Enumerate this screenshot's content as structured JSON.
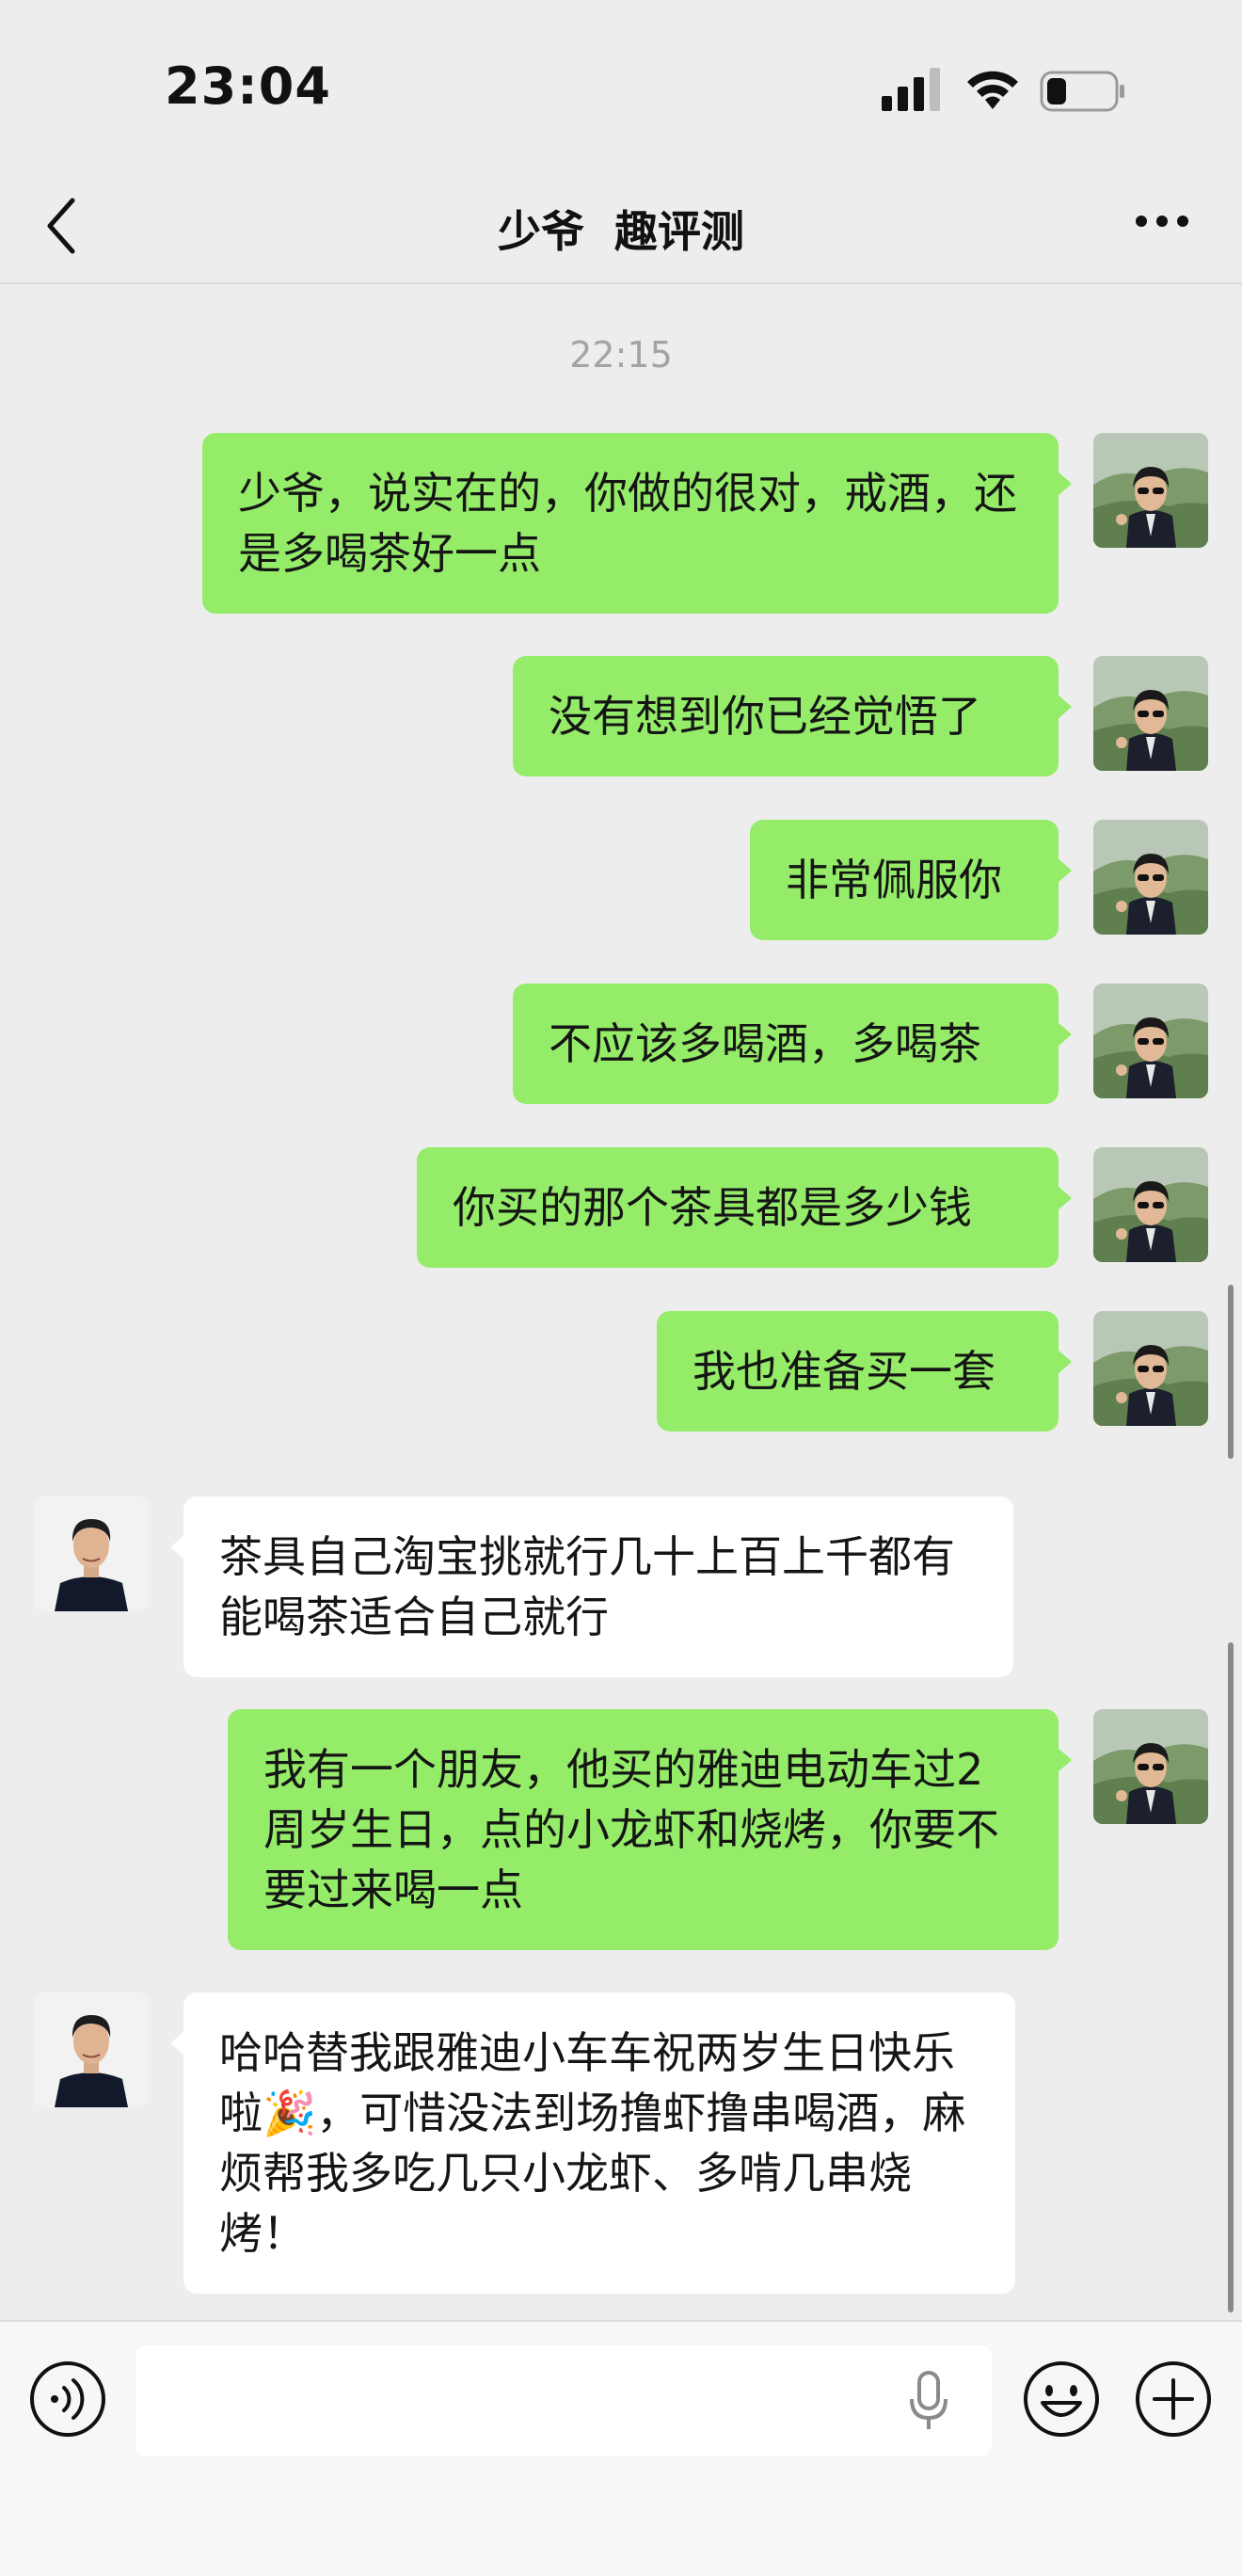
{
  "status_bar": {
    "time": "23:04",
    "icons": [
      "signal-icon",
      "wifi-icon",
      "battery-icon"
    ]
  },
  "nav": {
    "title": "少爷  趣评测",
    "icons": [
      "back-icon",
      "more-icon"
    ]
  },
  "chat": {
    "timestamp": "22:15",
    "messages": [
      {
        "side": "sent",
        "text": "少爷，说实在的，你做的很对，戒酒，还是多喝茶好一点"
      },
      {
        "side": "sent",
        "text": "没有想到你已经觉悟了"
      },
      {
        "side": "sent",
        "text": "非常佩服你"
      },
      {
        "side": "sent",
        "text": "不应该多喝酒，多喝茶"
      },
      {
        "side": "sent",
        "text": "你买的那个茶具都是多少钱"
      },
      {
        "side": "sent",
        "text": "我也准备买一套"
      },
      {
        "side": "received",
        "text": "茶具自己淘宝挑就行几十上百上千都有 能喝茶适合自己就行"
      },
      {
        "side": "sent",
        "text": "我有一个朋友，他买的雅迪电动车过2周岁生日，点的小龙虾和烧烤，你要不要过来喝一点"
      },
      {
        "side": "received",
        "text": "哈哈替我跟雅迪小车车祝两岁生日快乐啦🎉，可惜没法到场撸虾撸串喝酒，麻烦帮我多吃几只小龙虾、多啃几串烧烤！"
      }
    ]
  },
  "input_bar": {
    "value": "",
    "icons": [
      "voice-icon",
      "mic-icon",
      "emoji-icon",
      "plus-icon"
    ]
  },
  "colors": {
    "background": "#ededed",
    "sent_bubble": "#95ec69",
    "received_bubble": "#ffffff",
    "timestamp": "#a3a3a3"
  }
}
